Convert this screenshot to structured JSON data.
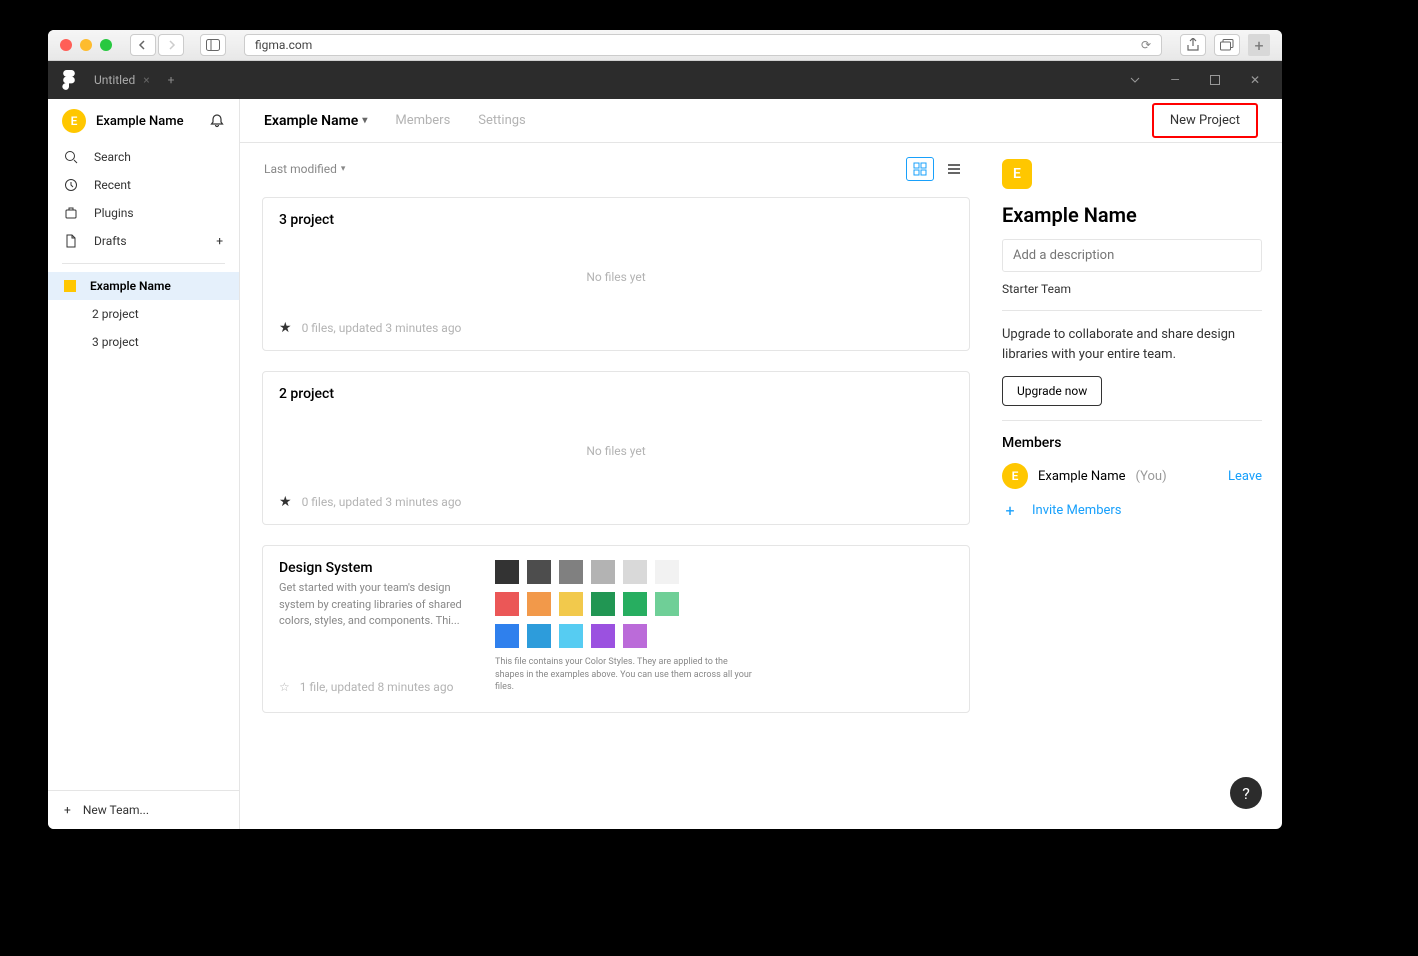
{
  "browser": {
    "url": "figma.com"
  },
  "figma_toolbar": {
    "tab_title": "Untitled"
  },
  "sidebar": {
    "user_name": "Example Name",
    "user_initial": "E",
    "nav": {
      "search": "Search",
      "recent": "Recent",
      "plugins": "Plugins",
      "drafts": "Drafts"
    },
    "team": {
      "name": "Example Name",
      "projects": [
        "2 project",
        "3 project"
      ]
    },
    "new_team": "New Team..."
  },
  "main_header": {
    "title": "Example Name",
    "members": "Members",
    "settings": "Settings",
    "new_project": "New Project"
  },
  "sort": {
    "label": "Last modified"
  },
  "projects": [
    {
      "title": "3 project",
      "empty": "No files yet",
      "meta": "0 files, updated 3 minutes ago",
      "starred": true
    },
    {
      "title": "2 project",
      "empty": "No files yet",
      "meta": "0 files, updated 3 minutes ago",
      "starred": true
    }
  ],
  "design_system": {
    "title": "Design System",
    "desc": "Get started with your team's design system by creating libraries of shared colors, styles, and components. Thi...",
    "meta": "1 file, updated 8 minutes ago",
    "caption": "This file contains your Color Styles. They are applied to the shapes in the examples above. You can use them across all your files.",
    "grays": [
      "#333333",
      "#4d4d4d",
      "#808080",
      "#b3b3b3",
      "#d9d9d9",
      "#f2f2f2"
    ],
    "colors": [
      "#eb5757",
      "#f2994a",
      "#f2c94c",
      "#219653",
      "#27ae60",
      "#6fcf97"
    ],
    "blues": [
      "#2f80ed",
      "#2d9cdb",
      "#56ccf2",
      "#9b51e0",
      "#bb6bd9"
    ]
  },
  "details": {
    "initial": "E",
    "name": "Example Name",
    "desc_placeholder": "Add a description",
    "plan": "Starter Team",
    "upgrade_text": "Upgrade to collaborate and share design libraries with your entire team.",
    "upgrade_btn": "Upgrade now",
    "members_title": "Members",
    "member_name": "Example Name",
    "member_you": "(You)",
    "leave": "Leave",
    "invite": "Invite Members"
  },
  "help": "?"
}
